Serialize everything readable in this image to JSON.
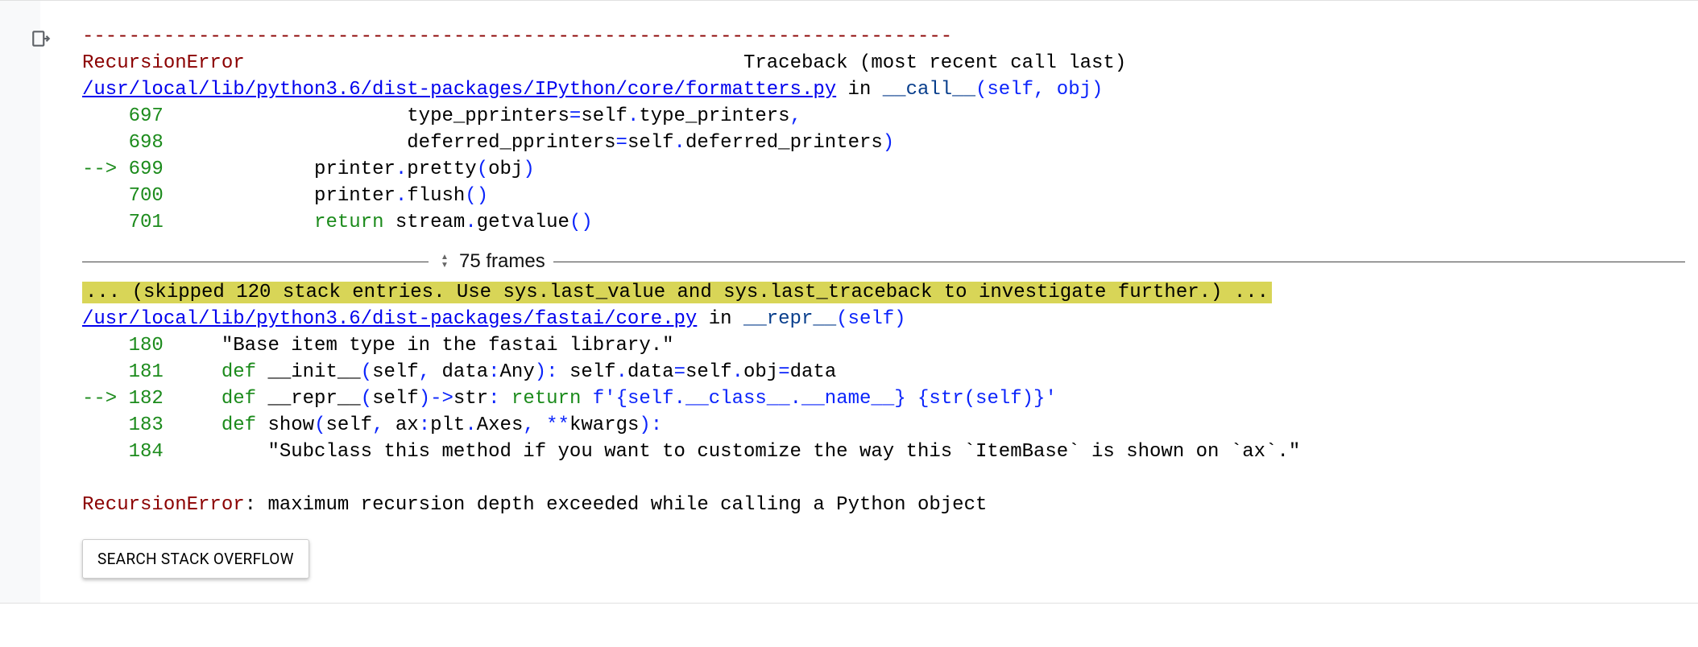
{
  "gutter": {
    "icon": "run-output"
  },
  "tb": {
    "divider": "---------------------------------------------------------------------------",
    "error_name": "RecursionError",
    "header_mid": "                                           ",
    "header_right": "Traceback (most recent call last)",
    "frame1": {
      "path": "/usr/local/lib/python3.6/dist-packages/IPython/core/formatters.py",
      "in_txt": " in ",
      "func": "__call__",
      "args": "(self, obj)",
      "lines": [
        {
          "arrow": "    ",
          "n": "697",
          "code_pre": "                     type_pprinters",
          "code_mid": "=",
          "code_post": "self",
          "op": ".",
          "tail": "type_printers",
          "end": ","
        },
        {
          "arrow": "    ",
          "n": "698",
          "code_pre": "                     deferred_pprinters",
          "code_mid": "=",
          "code_post": "self",
          "op": ".",
          "tail": "deferred_printers",
          "paren": ")"
        },
        {
          "arrow": "--> ",
          "n": "699",
          "code": "             printer",
          "op1": ".",
          "call": "pretty",
          "paren_o": "(",
          "arg": "obj",
          "paren_c": ")"
        },
        {
          "arrow": "    ",
          "n": "700",
          "code": "             printer",
          "op1": ".",
          "call": "flush",
          "paren_o": "(",
          "arg": "",
          "paren_c": ")"
        },
        {
          "arrow": "    ",
          "n": "701",
          "kw": "             return",
          "code": " stream",
          "op1": ".",
          "call": "getvalue",
          "paren_o": "(",
          "arg": "",
          "paren_c": ")"
        }
      ]
    },
    "frames_collapsed": "75 frames",
    "skipped_msg": "... (skipped 120 stack entries. Use sys.last_value and sys.last_traceback to investigate further.) ...",
    "frame2": {
      "path": "/usr/local/lib/python3.6/dist-packages/fastai/core.py",
      "in_txt": " in ",
      "func": "__repr__",
      "args": "(self)",
      "lines": [
        {
          "arrow": "    ",
          "n": "180",
          "code": "     \"Base item type in the fastai library.\""
        },
        {
          "arrow": "    ",
          "n": "181",
          "kw": "     def",
          "code": " __init__",
          "paren_o": "(",
          "args": "self",
          "comma": ",",
          "args2": " data",
          "colon": ":",
          "type": "Any",
          "paren_c": ")",
          "colon2": ":",
          "body": " self",
          "op": ".",
          "attr": "data",
          "eq": "=",
          "rhs": "self",
          "op2": ".",
          "attr2": "obj",
          "eq2": "=",
          "rhs2": "data"
        },
        {
          "arrow": "--> ",
          "n": "182",
          "kw": "     def",
          "code": " __repr__",
          "paren_o": "(",
          "args": "self",
          "paren_c": ")",
          "arrow_ret": "->",
          "rtype": "str",
          "colon2": ":",
          "kw2": " return",
          "fstr": " f'{self.__class__.__name__} {str(self)}'"
        },
        {
          "arrow": "    ",
          "n": "183",
          "kw": "     def",
          "code": " show",
          "paren_o": "(",
          "args": "self",
          "comma": ",",
          "args2": " ax",
          "colon": ":",
          "type": "plt",
          "op": ".",
          "attr": "Axes",
          "comma2": ",",
          "star": " **",
          "kwargs": "kwargs",
          "paren_c": ")",
          "colon2": ":"
        },
        {
          "arrow": "    ",
          "n": "184",
          "code": "         \"Subclass this method if you want to customize the way this `ItemBase` is shown on `ax`.\""
        }
      ]
    },
    "final_error_name": "RecursionError",
    "final_error_msg": ": maximum recursion depth exceeded while calling a Python object"
  },
  "button": {
    "label": "SEARCH STACK OVERFLOW"
  }
}
